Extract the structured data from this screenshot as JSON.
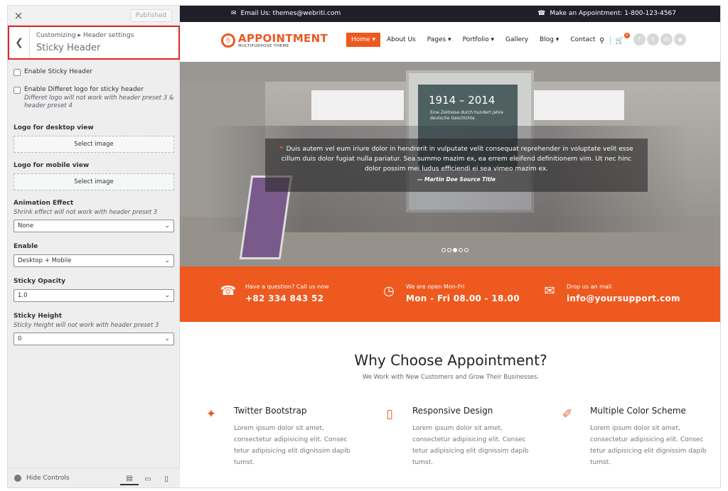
{
  "customizer": {
    "close_label": "×",
    "published_label": "Published",
    "breadcrumb": "Customizing ▸ Header settings",
    "title": "Sticky Header",
    "enable_sticky_label": "Enable Sticky Header",
    "different_logo_label": "Enable Differet logo for sticky header",
    "different_logo_desc": "Differet logo will not work with header preset 3 & header preset 4",
    "logo_desktop_label": "Logo for desktop view",
    "logo_desktop_button": "Select image",
    "logo_mobile_label": "Logo for mobile view",
    "logo_mobile_button": "Select image",
    "animation_label": "Animation Effect",
    "animation_desc": "Shrink effect will not work with header preset 3",
    "animation_value": "None",
    "enable_label": "Enable",
    "enable_value": "Desktop + Mobile",
    "opacity_label": "Sticky Opacity",
    "opacity_value": "1.0",
    "height_label": "Sticky Height",
    "height_desc": "Sticky Height will not work with header preset 3",
    "height_value": "0",
    "hide_controls_label": "Hide Controls"
  },
  "site": {
    "topbar": {
      "email": "Email Us: themes@webriti.com",
      "appointment": "Make an Appointment: 1-800-123-4567"
    },
    "logo": {
      "title": "APPOINTMENT",
      "subtitle": "MULTIPURPOSE THEME"
    },
    "menu": [
      {
        "label": "Home ▾"
      },
      {
        "label": "About Us"
      },
      {
        "label": "Pages ▾"
      },
      {
        "label": "Portfolio ▾"
      },
      {
        "label": "Gallery"
      },
      {
        "label": "Blog ▾"
      },
      {
        "label": "Contact"
      }
    ],
    "cart_count": "0",
    "hero": {
      "sign_year": "1914 – 2014",
      "sign_tagline": "Eine Zeitreise durch hundert Jahre deutsche Geschichte",
      "quote": "Duis autem vel eum iriure dolor in hendrerit in vulputate velit consequat reprehender in voluptate velit esse cillum duis dolor fugiat nulla pariatur. Sea summo mazim ex, ea errem eleifend definitionem vim. Ut nec hinc dolor possim mei ludus efficiendi ei sea vimeo mazim ex.",
      "author": "— Martin Doe Source Title"
    },
    "info": [
      {
        "label": "Have a question? Call us now",
        "value": "+82 334 843 52"
      },
      {
        "label": "We are open Mon-Fri",
        "value": "Mon - Fri 08.00 - 18.00"
      },
      {
        "label": "Drop us an mail",
        "value": "info@yoursupport.com"
      }
    ],
    "why": {
      "title": "Why Choose Appointment?",
      "subtitle": "We Work with New Customers and Grow Their Businesses."
    },
    "features": [
      {
        "title": "Twitter Bootstrap",
        "text": "Lorem ipsum dolor sit amet, consectetur adipisicing elit. Consec tetur adipisicing elit dignissim dapib tumst."
      },
      {
        "title": "Responsive Design",
        "text": "Lorem ipsum dolor sit amet, consectetur adipisicing elit. Consec tetur adipisicing elit dignissim dapib tumst."
      },
      {
        "title": "Multiple Color Scheme",
        "text": "Lorem ipsum dolor sit amet, consectetur adipisicing elit. Consec tetur adipisicing elit dignissim dapib tumst."
      }
    ]
  },
  "colors": {
    "accent": "#ee591f",
    "highlight_border": "#e0262b",
    "topbar": "#1f1f29"
  }
}
